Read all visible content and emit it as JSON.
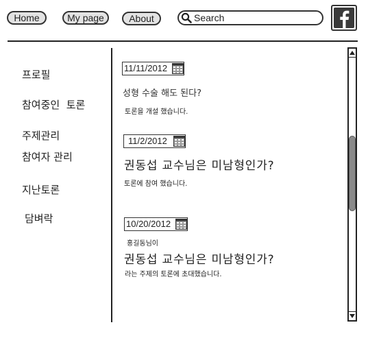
{
  "header": {
    "nav": [
      {
        "label": "Home"
      },
      {
        "label": "My page"
      },
      {
        "label": "About"
      }
    ],
    "search": {
      "placeholder": "Search"
    }
  },
  "sidebar": {
    "items": [
      {
        "label": "프로필"
      },
      {
        "label": "참여중인  토론"
      },
      {
        "label": "주제관리"
      },
      {
        "label": "참여자 관리"
      },
      {
        "label": "지난토론"
      },
      {
        "label": "담벼락"
      }
    ]
  },
  "feed": [
    {
      "date": "11/11/2012",
      "title": "성형 수술 해도 된다?",
      "desc": "토론을 개설 했습니다."
    },
    {
      "date": "11/2/2012",
      "title": "권동섭 교수님은 미남형인가?",
      "desc": "토론에 참여 했습니다."
    },
    {
      "date": "10/20/2012",
      "pre": "홍길동님이",
      "title": "권동섭 교수님은 미남형인가?",
      "desc": "라는 주제의 토론에 초대했습니다."
    }
  ],
  "icons": {
    "search": "search-icon",
    "facebook": "facebook-icon",
    "calendar": "calendar-icon",
    "scroll_up": "arrow-up-icon",
    "scroll_down": "arrow-down-icon"
  }
}
